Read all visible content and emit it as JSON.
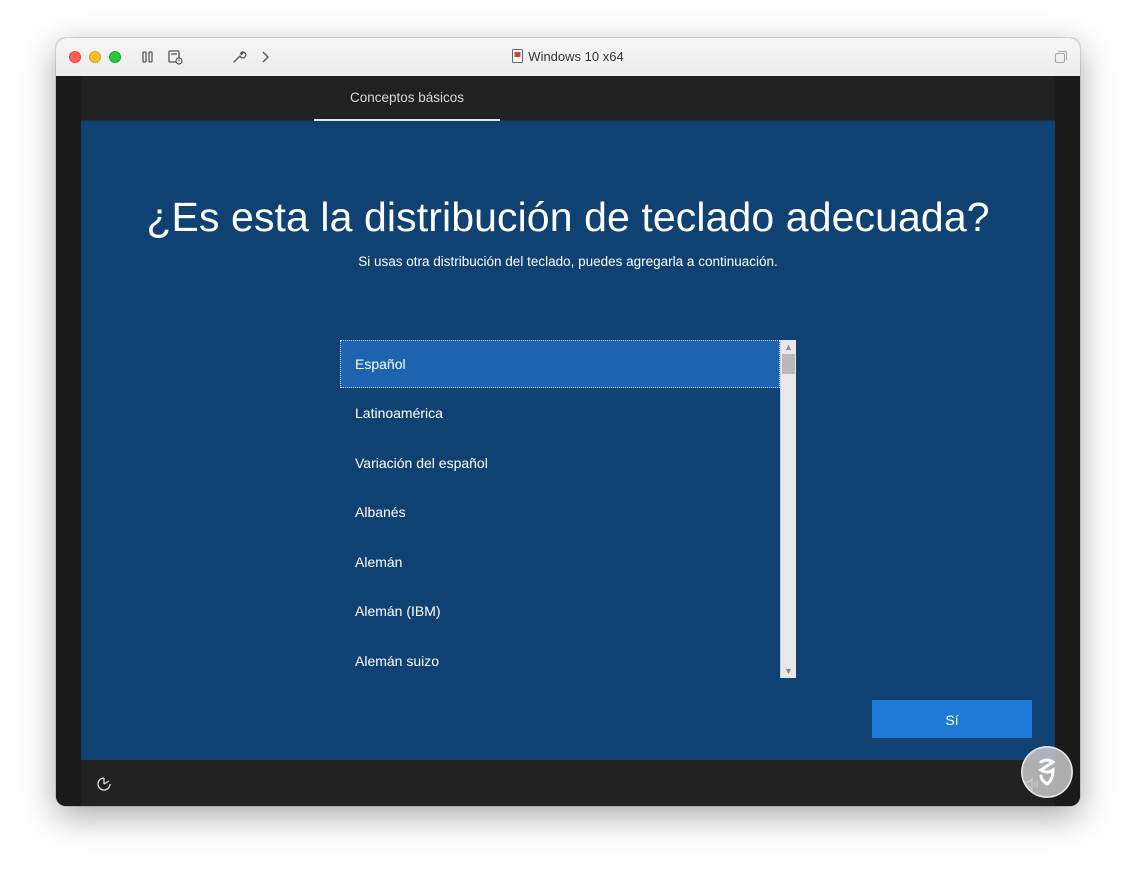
{
  "window": {
    "title": "Windows 10 x64"
  },
  "toolbar": {
    "icons": [
      "pause-icon",
      "snapshot-icon",
      "wrench-icon",
      "chevron-right-icon"
    ]
  },
  "oobe": {
    "tab_label": "Conceptos básicos",
    "heading": "¿Es esta la distribución de teclado adecuada?",
    "subheading": "Si usas otra distribución del teclado, puedes agregarla a continuación.",
    "layouts": [
      "Español",
      "Latinoamérica",
      "Variación del español",
      "Albanés",
      "Alemán",
      "Alemán (IBM)",
      "Alemán suizo"
    ],
    "selected_index": 0,
    "yes_button": "Sí"
  },
  "colors": {
    "oobe_background": "#0f4272",
    "selected_item": "#1c63b0",
    "button": "#1f79d6"
  }
}
